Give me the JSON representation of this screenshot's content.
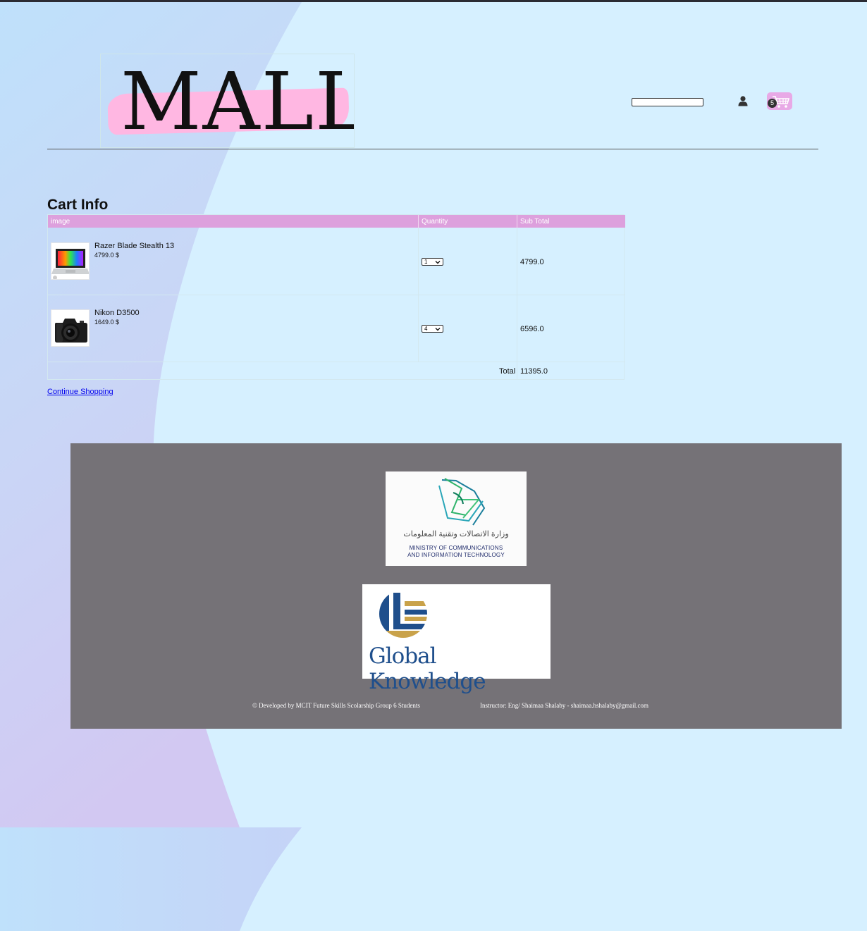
{
  "header": {
    "logo_text": "MALL",
    "search_placeholder": "",
    "cart_count": "5"
  },
  "cart": {
    "title": "Cart Info",
    "columns": [
      "image",
      "Quantity",
      "Sub Total"
    ],
    "items": [
      {
        "name": "Razer Blade Stealth 13",
        "price": "4799.0 $",
        "quantity": "1",
        "subtotal": "4799.0"
      },
      {
        "name": "Nikon D3500",
        "price": "1649.0 $",
        "quantity": "4",
        "subtotal": "6596.0"
      }
    ],
    "total_label": "Total",
    "total_value": "11395.0",
    "continue_link": "Continue Shopping"
  },
  "footer": {
    "mcit_arabic": "وزارة الاتصالات وتقنية المعلومات",
    "mcit_line1": "MINISTRY OF COMMUNICATIONS",
    "mcit_line2": "AND INFORMATION TECHNOLOGY",
    "gk_name": "Global Knowledge",
    "credit": "© Developed by MCIT Future Skills Scolarship Group 6 Students",
    "instructor": "Instructor: Eng/ Shaimaa Shalaby - shaimaa.hshalaby@gmail.com"
  },
  "colors": {
    "background": "#d6f0ff",
    "table_header": "#dda0dd",
    "footer": "#757277",
    "cart_icon": "#e8a9e6"
  },
  "icons": [
    "user-icon",
    "cart-icon",
    "caret-down-icon",
    "laptop-image",
    "camera-image",
    "mcit-logo",
    "global-knowledge-logo"
  ]
}
